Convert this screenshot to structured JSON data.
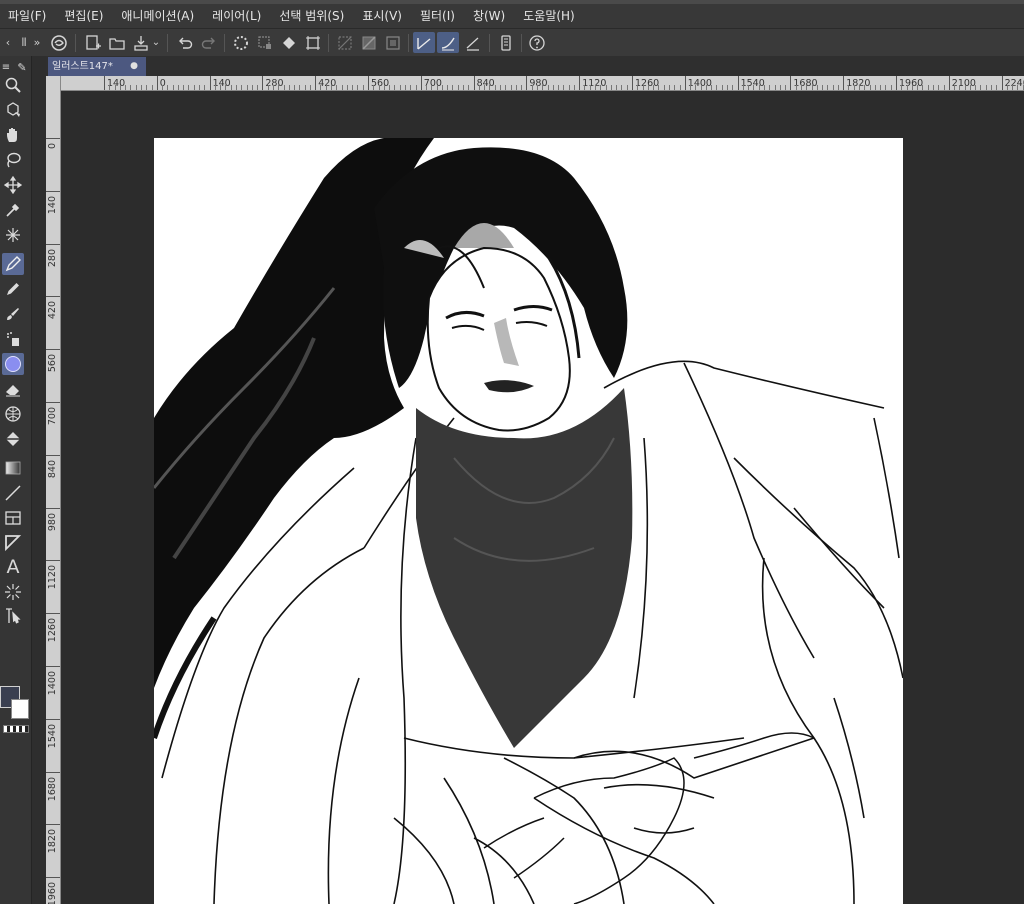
{
  "menu": [
    "파일(F)",
    "편집(E)",
    "애니메이션(A)",
    "레이어(L)",
    "선택 범위(S)",
    "표시(V)",
    "필터(I)",
    "창(W)",
    "도움말(H)"
  ],
  "document_tab": {
    "title": "일러스트147*",
    "close_glyph": "●"
  },
  "ruler": {
    "horizontal_labels": [
      "140",
      "0",
      "140",
      "280",
      "420",
      "560",
      "700",
      "840",
      "980",
      "1120",
      "1260",
      "1400",
      "1540",
      "1680",
      "1820",
      "1960",
      "2100",
      "2240"
    ],
    "vertical_labels": [
      "0",
      "140",
      "280",
      "420",
      "560",
      "700",
      "840",
      "980",
      "1120",
      "1260",
      "1400",
      "1540",
      "1680",
      "1820",
      "1960"
    ]
  },
  "command_icons": [
    "clip-studio-icon",
    "new-file-icon",
    "open-file-icon",
    "save-icon",
    "undo-icon",
    "redo-icon",
    "loading-icon",
    "clear-icon",
    "fill-icon",
    "transform-icon",
    "deselect-icon",
    "invert-selection-icon",
    "show-border-icon",
    "snap-ruler-icon",
    "snap-special-icon",
    "snap-grid-icon",
    "tablet-icon",
    "help-icon"
  ],
  "tools": [
    "zoom-icon",
    "camera-icon",
    "hand-icon",
    "lasso-icon",
    "move-icon",
    "eyedropper-icon",
    "sparkle-icon",
    "pen-icon",
    "pencil-icon",
    "brush-icon",
    "airbrush-icon",
    "decoration-icon",
    "eraser-icon",
    "blend-icon",
    "fill-bucket-icon",
    "gradient-icon",
    "line-icon",
    "frame-icon",
    "ruler-icon",
    "text-icon",
    "balloon-icon",
    "operation-icon"
  ],
  "colors": {
    "main": "#3a3f50",
    "sub": "#ffffff",
    "accent": "#5a6a96",
    "panel": "#383838"
  }
}
